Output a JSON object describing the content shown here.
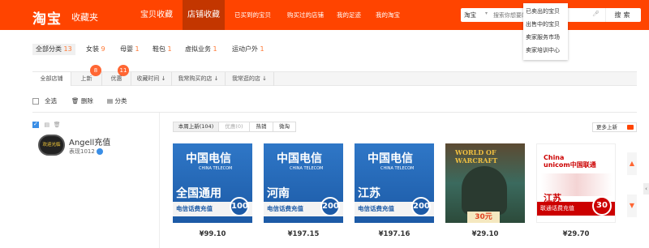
{
  "header": {
    "logo": "淘宝",
    "title": "收藏夹",
    "main_tabs": [
      "宝贝收藏",
      "店铺收藏"
    ],
    "links": [
      "已买到的宝贝",
      "购买过的店铺",
      "我的足迹",
      "我的淘宝"
    ],
    "search": {
      "scope": "淘宝",
      "placeholder": "搜索你想要的宝贝",
      "button": "搜索"
    },
    "dropdown": [
      "已卖出的宝贝",
      "出售中的宝贝",
      "卖家服务市场",
      "卖家培训中心"
    ]
  },
  "categories": [
    {
      "label": "全部分类",
      "count": "13"
    },
    {
      "label": "女装",
      "count": "9"
    },
    {
      "label": "母婴",
      "count": "1"
    },
    {
      "label": "鞋包",
      "count": "1"
    },
    {
      "label": "虚拟业务",
      "count": "1"
    },
    {
      "label": "运动户外",
      "count": "1"
    }
  ],
  "sort_tabs": [
    {
      "label": "全部店铺"
    },
    {
      "label": "上新",
      "badge": "8"
    },
    {
      "label": "优惠",
      "badge": "11"
    },
    {
      "label": "收藏时间"
    },
    {
      "label": "我常购买的店"
    },
    {
      "label": "我常逛的店"
    }
  ],
  "actions": {
    "select_all": "全选",
    "delete": "删除",
    "classify": "分类"
  },
  "shop": {
    "logo_text": "欢迎光临",
    "name": "Angell充值",
    "reputation": "表现1012"
  },
  "product_tabs": [
    "本周上新(104)",
    "优惠(0)",
    "热销",
    "微淘"
  ],
  "more_new": "更多上新",
  "products": [
    {
      "type": "telecom",
      "logo": "中国电信",
      "sub": "CHINA TELECOM",
      "region": "全国通用",
      "strip": "电信话费充值",
      "amount": "100",
      "price": "¥99.10"
    },
    {
      "type": "telecom",
      "logo": "中国电信",
      "sub": "CHINA TELECOM",
      "region": "河南",
      "strip": "电信话费充值",
      "amount": "200",
      "price": "¥197.15"
    },
    {
      "type": "telecom",
      "logo": "中国电信",
      "sub": "CHINA TELECOM",
      "region": "江苏",
      "strip": "电信话费充值",
      "amount": "200",
      "price": "¥197.16"
    },
    {
      "type": "wow",
      "game": "WORLD OF WARCRAFT",
      "amount": "30元",
      "price": "¥29.10"
    },
    {
      "type": "unicom",
      "logo_line1": "China",
      "logo_line2": "unicom中国联通",
      "region": "江苏",
      "strip": "联通话费充值",
      "amount": "30",
      "price": "¥29.70"
    }
  ],
  "colors": {
    "brand": "#ff4400",
    "accent": "#ff6633",
    "telecom": "#1c5aa6",
    "unicom": "#cc0000"
  }
}
